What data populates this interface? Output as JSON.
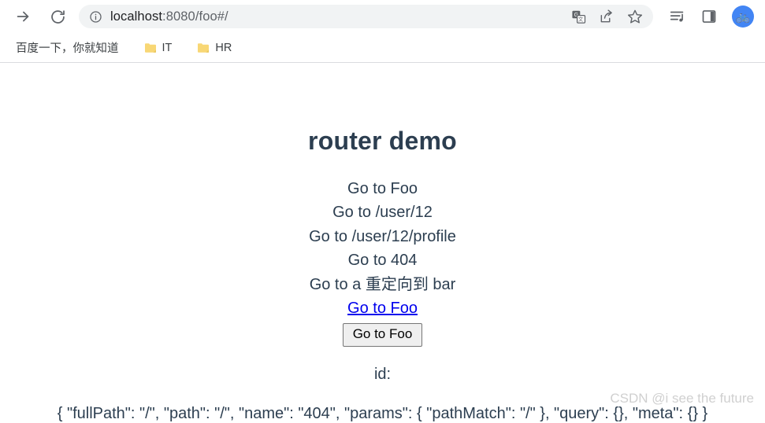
{
  "browser": {
    "nav": {
      "forward_icon": "arrow-right-icon",
      "reload_icon": "reload-icon"
    },
    "omnibox": {
      "info_icon": "info-circle-icon",
      "url_host": "localhost",
      "url_rest": ":8080/foo#/",
      "full_url": "localhost:8080/foo#/",
      "actions": [
        {
          "name": "translate-icon",
          "glyph": "translate"
        },
        {
          "name": "share-icon",
          "glyph": "share"
        },
        {
          "name": "bookmark-star-icon",
          "glyph": "star"
        }
      ]
    },
    "toolbar_right": [
      {
        "name": "reading-list-icon",
        "glyph": "reading-list"
      },
      {
        "name": "side-panel-icon",
        "glyph": "side-panel"
      }
    ],
    "avatar": {
      "name": "profile-avatar",
      "glyph": "🚲",
      "color": "#4285f4"
    }
  },
  "bookmarks": {
    "items": [
      {
        "label": "百度一下，你就知道",
        "has_folder_icon": false
      },
      {
        "label": "IT",
        "has_folder_icon": true
      },
      {
        "label": "HR",
        "has_folder_icon": true
      }
    ],
    "folder_color": "#f8d775"
  },
  "page": {
    "title": "router demo",
    "nav_lines": [
      "Go to Foo",
      "Go to /user/12",
      "Go to /user/12/profile",
      "Go to 404",
      "Go to a 重定向到 bar"
    ],
    "plain_link": "Go to Foo",
    "button_label": "Go to Foo",
    "id_label": "id:",
    "route_json": "{ \"fullPath\": \"/\", \"path\": \"/\", \"name\": \"404\", \"params\": { \"pathMatch\": \"/\" }, \"query\": {}, \"meta\": {} }",
    "watermark": "CSDN @i see the future",
    "title_color": "#2c3e50",
    "link_color": "#0000ee"
  }
}
